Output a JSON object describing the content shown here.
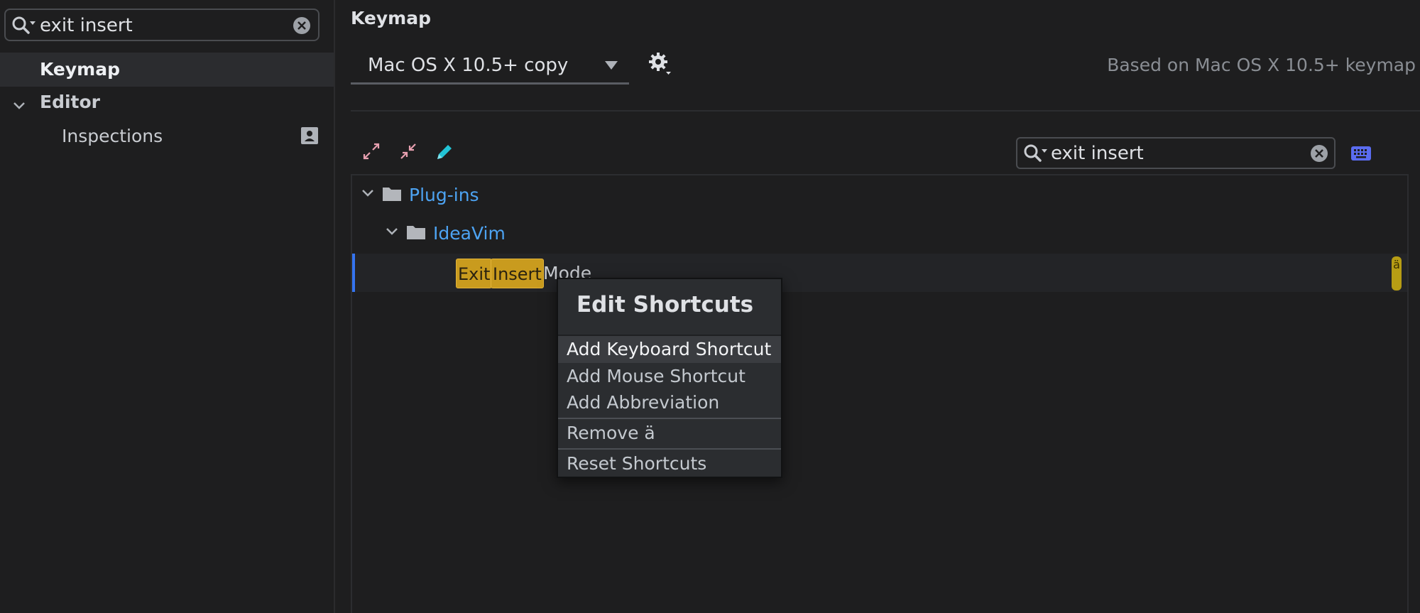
{
  "sidebar": {
    "search": {
      "value": "exit insert"
    },
    "items": [
      {
        "label": "Keymap",
        "selected": true
      },
      {
        "label": "Editor",
        "expanded": true
      },
      {
        "label": "Inspections"
      }
    ]
  },
  "panel": {
    "title": "Keymap",
    "keymap_select": {
      "value": "Mac OS X 10.5+ copy"
    },
    "based_on": "Based on Mac OS X 10.5+ keymap",
    "search": {
      "value": "exit insert"
    }
  },
  "tree": {
    "group": {
      "label": "Plug-ins"
    },
    "subgroup": {
      "label": "IdeaVim"
    },
    "action": {
      "highlight_words": [
        "Exit",
        "Insert"
      ],
      "rest": "Mode",
      "shortcut": "ä"
    }
  },
  "popup": {
    "title": "Edit Shortcuts",
    "items": [
      {
        "label": "Add Keyboard Shortcut"
      },
      {
        "label": "Add Mouse Shortcut"
      },
      {
        "label": "Add Abbreviation"
      },
      {
        "label": "Remove ä"
      },
      {
        "label": "Reset Shortcuts"
      }
    ]
  },
  "colors": {
    "background": "#1e1e1f",
    "link_blue": "#4da3f2",
    "search_highlight": "#c99b1e",
    "selection_accent": "#3574f0"
  },
  "icons": {
    "search": "magnifier-with-dropdown-icon",
    "clear": "circle-x-icon",
    "expand_all": "expand-all-icon",
    "collapse_all": "collapse-all-icon",
    "edit": "pencil-icon",
    "keyboard": "keyboard-icon",
    "gear": "gear-icon",
    "folder": "folder-icon",
    "project_scope": "person-card-icon"
  }
}
